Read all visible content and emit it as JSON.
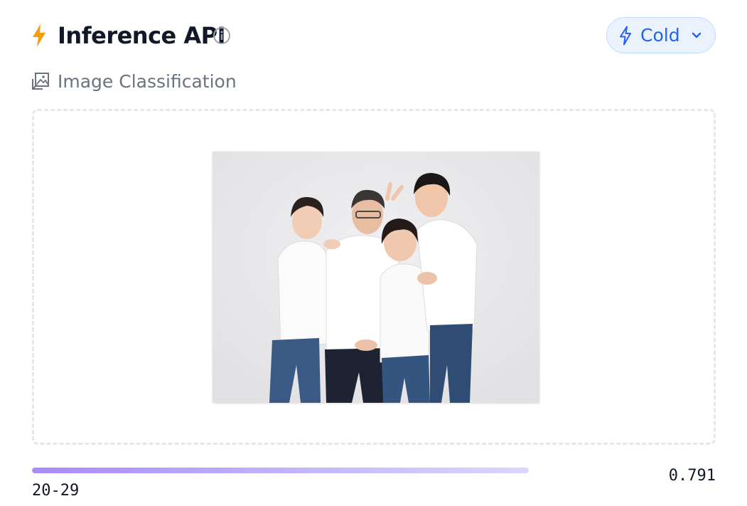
{
  "header": {
    "title": "Inference API",
    "accent_color": "#f59e0b",
    "icons": [
      "lightning-icon",
      "info-icon"
    ]
  },
  "status": {
    "label": "Cold",
    "icon": "lightning-icon",
    "dropdown_icon": "chevron-down-icon",
    "color": "#2563eb"
  },
  "task": {
    "label": "Image Classification",
    "icon": "image-classification-icon"
  },
  "dropzone": {
    "image_description_icon": "uploaded-photo"
  },
  "results": [
    {
      "label": "20-29",
      "score": "0.791",
      "fraction": 0.791
    }
  ]
}
